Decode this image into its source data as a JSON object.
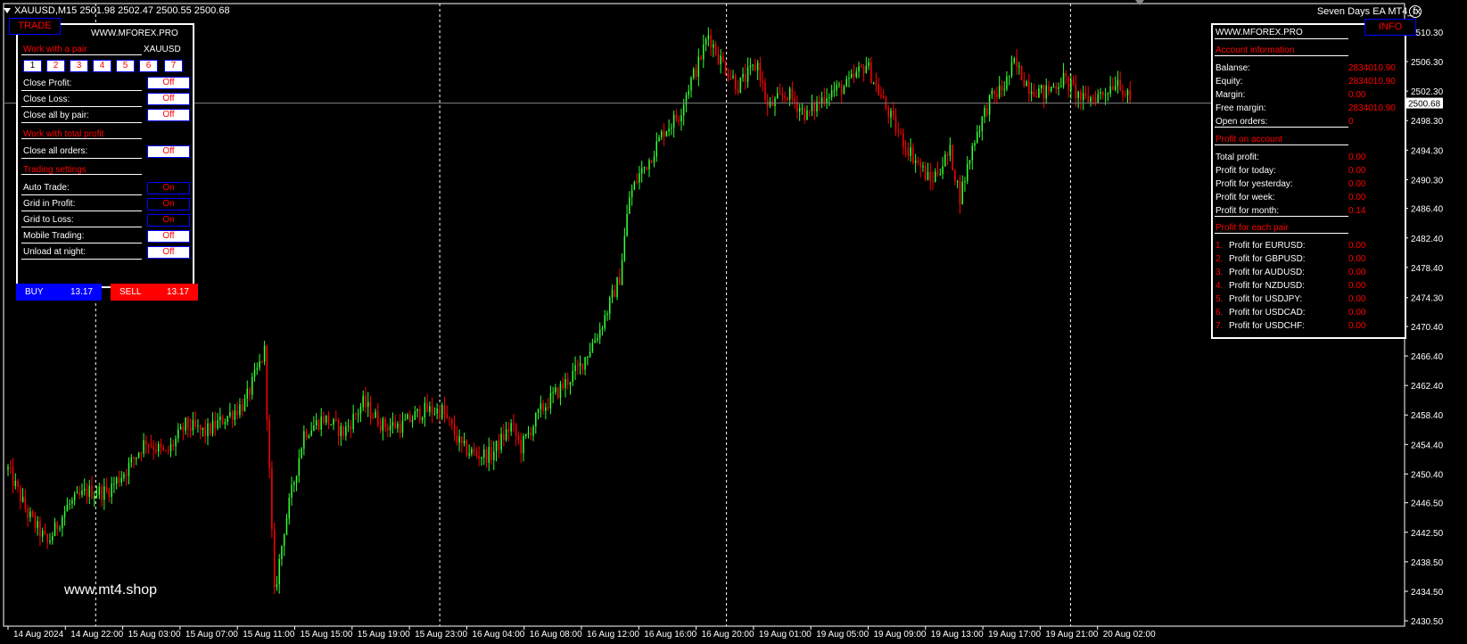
{
  "header": {
    "symbol_info": "XAUUSD,M15  2501.98 2502.47 2500.55 2500.68",
    "ea_name": "Seven Days EA MT4_fx",
    "ea_smile": "☺"
  },
  "colors": {
    "bull": "#33ff33",
    "bear": "#ff0000",
    "grid": "#ffffff",
    "price_line": "#808080",
    "background": "#000000"
  },
  "left_panel": {
    "tab_label": "TRADE",
    "site": "WWW.MFOREX.PRO",
    "section_pair": "Work with a pair",
    "pair": "XAUUSD",
    "pair_buttons": [
      "1",
      "2",
      "3",
      "4",
      "5",
      "6",
      "7"
    ],
    "close_profit_label": "Close Profit:",
    "close_profit_value": "Off",
    "close_loss_label": "Close Loss:",
    "close_loss_value": "Off",
    "close_all_pair_label": "Close all by pair:",
    "close_all_pair_value": "Off",
    "section_total": "Work with total profit",
    "close_all_orders_label": "Close all orders:",
    "close_all_orders_value": "Off",
    "section_settings": "Trading settings",
    "auto_trade_label": "Auto Trade:",
    "auto_trade_value": "On",
    "grid_profit_label": "Grid in Profit:",
    "grid_profit_value": "On",
    "grid_loss_label": "Grid to Loss:",
    "grid_loss_value": "On",
    "mobile_label": "Mobile Trading:",
    "mobile_value": "Off",
    "unload_label": "Unload at night:",
    "unload_value": "Off",
    "buy_label": "BUY",
    "buy_lot": "13.17",
    "sell_label": "SELL",
    "sell_lot": "13.17"
  },
  "right_panel": {
    "tab_label": "INFO",
    "site": "WWW.MFOREX.PRO",
    "section_account": "Account information",
    "balance_label": "Balanse:",
    "balance_value": "2834010.90",
    "equity_label": "Equity:",
    "equity_value": "2834010.90",
    "margin_label": "Margin:",
    "margin_value": "0.00",
    "free_margin_label": "Free margin:",
    "free_margin_value": "2834010.90",
    "open_orders_label": "Open orders:",
    "open_orders_value": "0",
    "section_profit": "Profit on account",
    "total_profit_label": "Total profit:",
    "total_profit_value": "0.00",
    "today_label": "Profit for today:",
    "today_value": "0.00",
    "yesterday_label": "Profit for yesterday:",
    "yesterday_value": "0.00",
    "week_label": "Profit for week:",
    "week_value": "0.00",
    "month_label": "Profit for month:",
    "month_value": "0.14",
    "section_pairs": "Profit for each pair",
    "pairs": [
      {
        "num": "1.",
        "label": "Profit for EURUSD:",
        "value": "0.00"
      },
      {
        "num": "2.",
        "label": "Profit for GBPUSD:",
        "value": "0.00"
      },
      {
        "num": "3.",
        "label": "Profit for AUDUSD:",
        "value": "0.00"
      },
      {
        "num": "4.",
        "label": "Profit for NZDUSD:",
        "value": "0.00"
      },
      {
        "num": "5.",
        "label": "Profit for USDJPY:",
        "value": "0.00"
      },
      {
        "num": "6.",
        "label": "Profit for USDCAD:",
        "value": "0.00"
      },
      {
        "num": "7.",
        "label": "Profit for USDCHF:",
        "value": "0.00"
      }
    ]
  },
  "watermark": "www.mt4.shop",
  "chart_data": {
    "type": "candlestick",
    "symbol": "XAUUSD",
    "timeframe": "M15",
    "last_price": "2500.68",
    "y_ticks": [
      "2510.30",
      "2506.30",
      "2502.30",
      "2498.30",
      "2494.30",
      "2490.30",
      "2486.40",
      "2482.40",
      "2478.40",
      "2474.30",
      "2470.40",
      "2466.40",
      "2462.40",
      "2458.40",
      "2454.40",
      "2450.40",
      "2446.50",
      "2442.50",
      "2438.50",
      "2434.50",
      "2430.50"
    ],
    "x_ticks": [
      "14 Aug 2024",
      "14 Aug 22:00",
      "15 Aug 03:00",
      "15 Aug 07:00",
      "15 Aug 11:00",
      "15 Aug 15:00",
      "15 Aug 19:00",
      "15 Aug 23:00",
      "16 Aug 04:00",
      "16 Aug 08:00",
      "16 Aug 12:00",
      "16 Aug 16:00",
      "16 Aug 20:00",
      "19 Aug 01:00",
      "19 Aug 05:00",
      "19 Aug 09:00",
      "19 Aug 13:00",
      "19 Aug 17:00",
      "19 Aug 21:00",
      "20 Aug 02:00"
    ],
    "ylim": [
      2430.5,
      2510.3
    ],
    "period_separators": [
      "14 Aug 22:00",
      "15 Aug 23:00",
      "16 Aug 20:00",
      "19 Aug 21:00"
    ],
    "close_path": [
      [
        0,
        2451
      ],
      [
        8,
        2445
      ],
      [
        16,
        2441
      ],
      [
        24,
        2446
      ],
      [
        32,
        2448
      ],
      [
        40,
        2448
      ],
      [
        48,
        2451
      ],
      [
        56,
        2455
      ],
      [
        64,
        2453
      ],
      [
        72,
        2457
      ],
      [
        80,
        2456
      ],
      [
        88,
        2458
      ],
      [
        96,
        2460
      ],
      [
        104,
        2467
      ],
      [
        108,
        2434
      ],
      [
        112,
        2443
      ],
      [
        120,
        2456
      ],
      [
        128,
        2458
      ],
      [
        136,
        2456
      ],
      [
        144,
        2460
      ],
      [
        152,
        2457
      ],
      [
        160,
        2457
      ],
      [
        168,
        2459
      ],
      [
        176,
        2459
      ],
      [
        184,
        2454
      ],
      [
        190,
        2453
      ],
      [
        196,
        2453
      ],
      [
        204,
        2457
      ],
      [
        208,
        2454
      ],
      [
        216,
        2459
      ],
      [
        224,
        2462
      ],
      [
        232,
        2465
      ],
      [
        240,
        2470
      ],
      [
        248,
        2477
      ],
      [
        252,
        2488
      ],
      [
        256,
        2491
      ],
      [
        260,
        2493
      ],
      [
        266,
        2497
      ],
      [
        272,
        2499
      ],
      [
        276,
        2503
      ],
      [
        280,
        2506
      ],
      [
        284,
        2510
      ],
      [
        288,
        2507
      ],
      [
        292,
        2505
      ],
      [
        296,
        2503
      ],
      [
        304,
        2506
      ],
      [
        308,
        2500
      ],
      [
        316,
        2502
      ],
      [
        324,
        2499
      ],
      [
        332,
        2502
      ],
      [
        340,
        2503
      ],
      [
        348,
        2506
      ],
      [
        356,
        2500
      ],
      [
        362,
        2496
      ],
      [
        368,
        2493
      ],
      [
        374,
        2490
      ],
      [
        378,
        2492
      ],
      [
        382,
        2494
      ],
      [
        386,
        2488
      ],
      [
        392,
        2496
      ],
      [
        398,
        2501
      ],
      [
        404,
        2503
      ],
      [
        408,
        2506
      ],
      [
        414,
        2503
      ],
      [
        420,
        2502
      ],
      [
        428,
        2504
      ],
      [
        436,
        2501
      ],
      [
        444,
        2502
      ],
      [
        450,
        2504
      ],
      [
        456,
        2500
      ]
    ],
    "bars_count": 456
  }
}
